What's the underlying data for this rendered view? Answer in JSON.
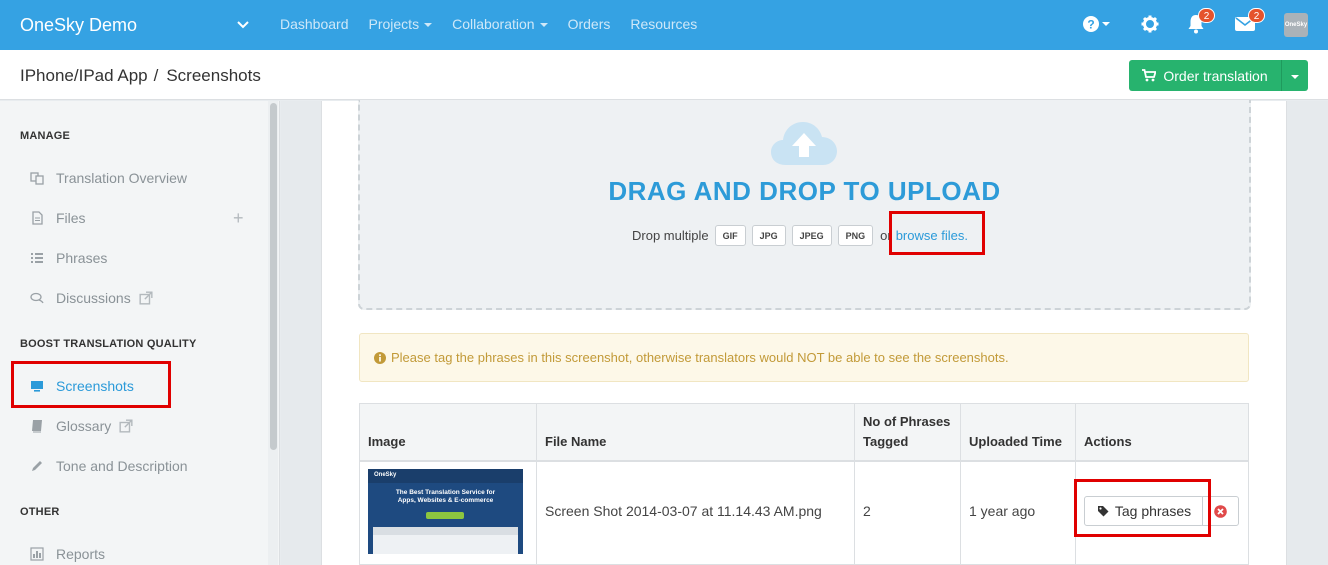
{
  "app": {
    "brand": "OneSky Demo",
    "nav": [
      {
        "label": "Dashboard",
        "dropdown": false
      },
      {
        "label": "Projects",
        "dropdown": true
      },
      {
        "label": "Collaboration",
        "dropdown": true
      },
      {
        "label": "Orders",
        "dropdown": false
      },
      {
        "label": "Resources",
        "dropdown": false
      }
    ],
    "notifications_count": "2",
    "messages_count": "2",
    "avatar_text": "OneSky",
    "accent_color": "#35a2e3"
  },
  "breadcrumb": {
    "project": "IPhone/IPad App",
    "separator": "/",
    "page": "Screenshots"
  },
  "order_button": {
    "label": "Order translation",
    "color": "#27b36e"
  },
  "sidebar": {
    "sections": [
      {
        "title": "MANAGE",
        "items": [
          {
            "label": "Translation Overview",
            "icon": "translate-icon"
          },
          {
            "label": "Files",
            "icon": "file-icon"
          },
          {
            "label": "Phrases",
            "icon": "list-icon"
          },
          {
            "label": "Discussions",
            "icon": "comments-icon"
          }
        ]
      },
      {
        "title": "BOOST TRANSLATION QUALITY",
        "items": [
          {
            "label": "Screenshots",
            "icon": "monitor-icon",
            "active": true
          },
          {
            "label": "Glossary",
            "icon": "book-icon"
          },
          {
            "label": "Tone and Description",
            "icon": "pencil-icon"
          }
        ]
      },
      {
        "title": "OTHER",
        "items": [
          {
            "label": "Reports",
            "icon": "bar-chart-icon"
          }
        ]
      }
    ]
  },
  "upload": {
    "title": "DRAG AND DROP TO UPLOAD",
    "prefix": "Drop multiple",
    "formats": [
      "GIF",
      "JPG",
      "JPEG",
      "PNG"
    ],
    "or": "or",
    "browse_label": "browse files."
  },
  "alert": {
    "text": "Please tag the phrases in this screenshot, otherwise translators would NOT be able to see the screenshots."
  },
  "table": {
    "headers": {
      "image": "Image",
      "file_name": "File Name",
      "phrases_line1": "No of Phrases",
      "phrases_line2": "Tagged",
      "uploaded": "Uploaded Time",
      "actions": "Actions"
    },
    "rows": [
      {
        "file_name": "Screen Shot 2014-03-07 at 11.14.43 AM.png",
        "phrases_tagged": "2",
        "uploaded": "1 year ago",
        "tag_button": "Tag phrases",
        "thumb_logo": "OneSky",
        "thumb_heading_1": "The Best Translation Service for",
        "thumb_heading_2": "Apps, Websites & E-commerce"
      }
    ]
  }
}
